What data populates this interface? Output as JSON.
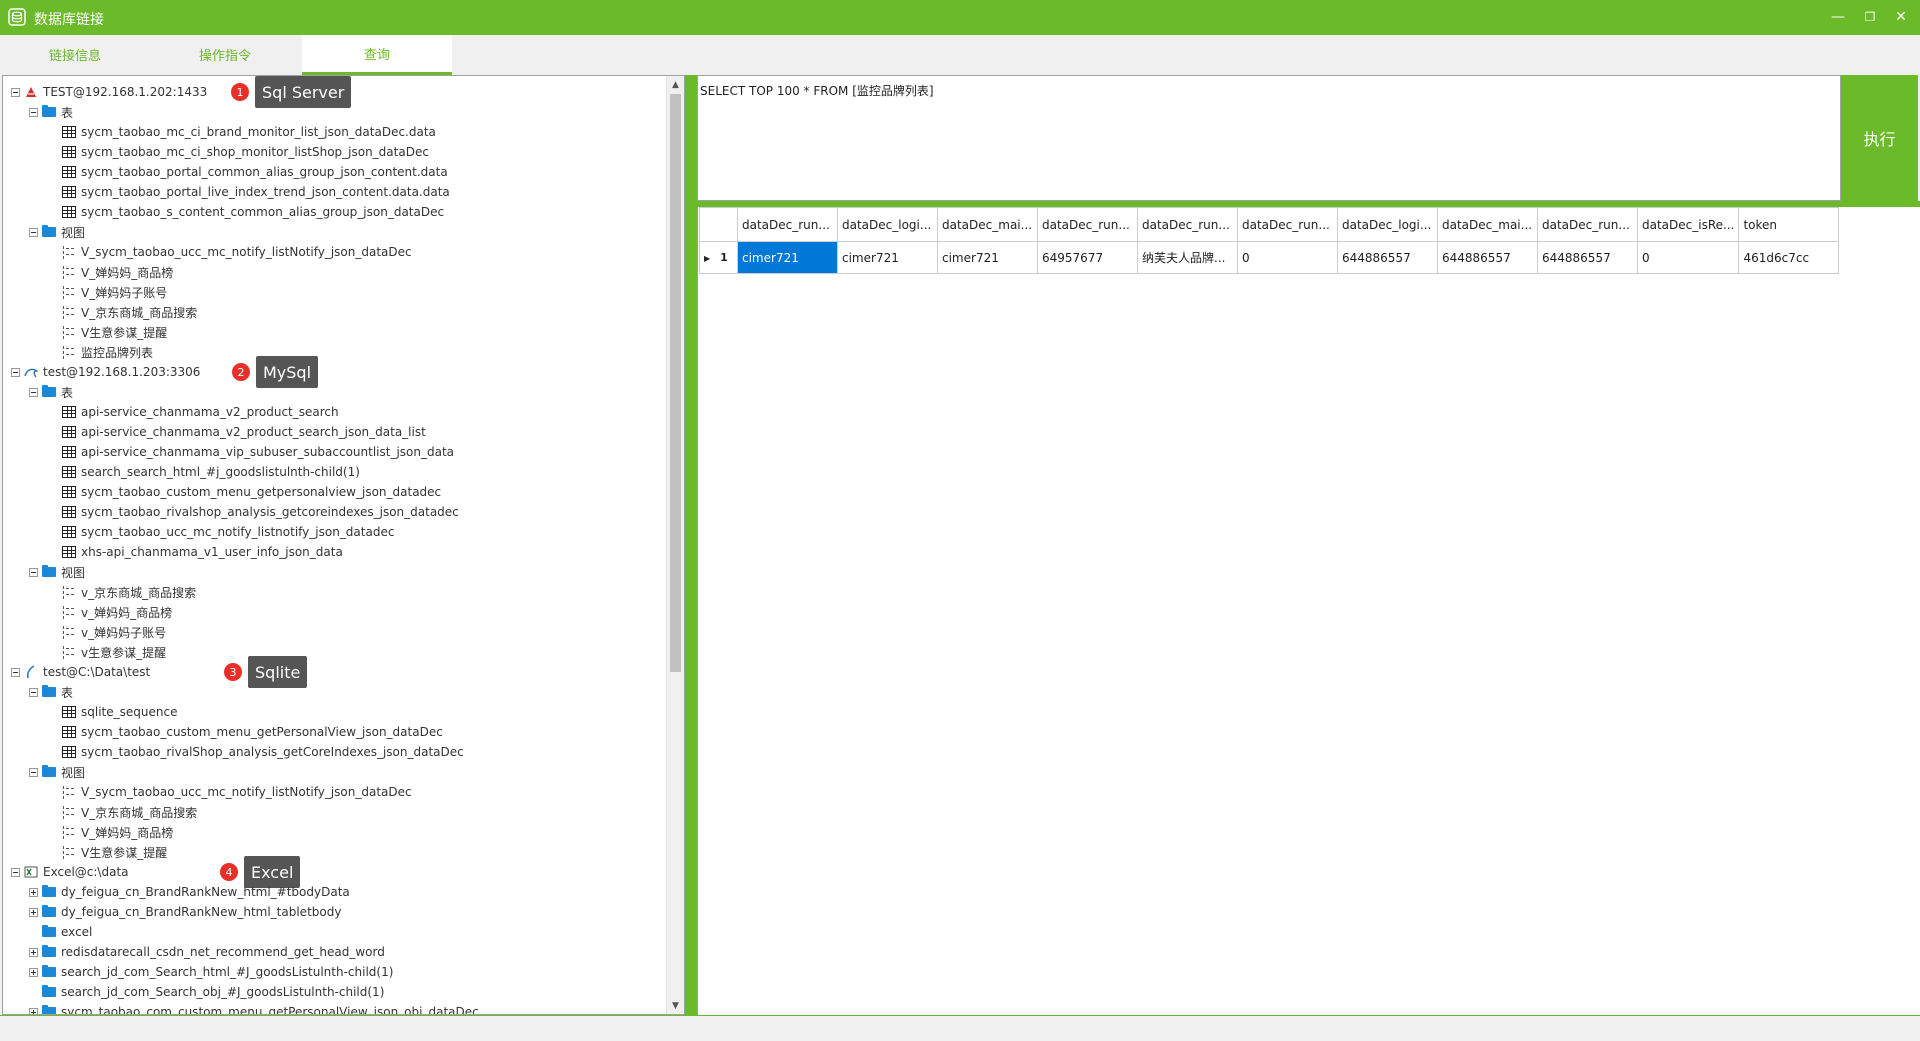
{
  "window": {
    "title": "数据库链接",
    "accent": "#6aba29",
    "controls": {
      "minimize": "—",
      "restore": "❐",
      "close": "✕"
    }
  },
  "tabs": [
    {
      "label": "链接信息",
      "active": false
    },
    {
      "label": "操作指令",
      "active": false
    },
    {
      "label": "查询",
      "active": true
    }
  ],
  "tree": {
    "connections": [
      {
        "label": "TEST@192.168.1.202:1433",
        "icon": "sqlserver-icon",
        "callout": {
          "number": "1",
          "label": "Sql Server"
        },
        "tables_label": "表",
        "tables": [
          "sycm_taobao_mc_ci_brand_monitor_list_json_dataDec.data",
          "sycm_taobao_mc_ci_shop_monitor_listShop_json_dataDec",
          "sycm_taobao_portal_common_alias_group_json_content.data",
          "sycm_taobao_portal_live_index_trend_json_content.data.data",
          "sycm_taobao_s_content_common_alias_group_json_dataDec"
        ],
        "views_label": "视图",
        "views": [
          "V_sycm_taobao_ucc_mc_notify_listNotify_json_dataDec",
          "V_婵妈妈_商品榜",
          "V_婵妈妈子账号",
          "V_京东商城_商品搜索",
          "V生意参谋_提醒",
          "监控品牌列表"
        ]
      },
      {
        "label": "test@192.168.1.203:3306",
        "icon": "mysql-icon",
        "callout": {
          "number": "2",
          "label": "MySql"
        },
        "tables_label": "表",
        "tables": [
          "api-service_chanmama_v2_product_search",
          "api-service_chanmama_v2_product_search_json_data_list",
          "api-service_chanmama_vip_subuser_subaccountlist_json_data",
          "search_search_html_#j_goodslistulnth-child(1)",
          "sycm_taobao_custom_menu_getpersonalview_json_datadec",
          "sycm_taobao_rivalshop_analysis_getcoreindexes_json_datadec",
          "sycm_taobao_ucc_mc_notify_listnotify_json_datadec",
          "xhs-api_chanmama_v1_user_info_json_data"
        ],
        "views_label": "视图",
        "views": [
          "v_京东商城_商品搜索",
          "v_婵妈妈_商品榜",
          "v_婵妈妈子账号",
          "v生意参谋_提醒"
        ]
      },
      {
        "label": "test@C:\\Data\\test",
        "icon": "sqlite-icon",
        "callout": {
          "number": "3",
          "label": "Sqlite"
        },
        "tables_label": "表",
        "tables": [
          "sqlite_sequence",
          "sycm_taobao_custom_menu_getPersonalView_json_dataDec",
          "sycm_taobao_rivalShop_analysis_getCoreIndexes_json_dataDec"
        ],
        "views_label": "视图",
        "views": [
          "V_sycm_taobao_ucc_mc_notify_listNotify_json_dataDec",
          "V_京东商城_商品搜索",
          "V_婵妈妈_商品榜",
          "V生意参谋_提醒"
        ]
      },
      {
        "label": "Excel@c:\\data",
        "icon": "excel-icon",
        "callout": {
          "number": "4",
          "label": "Excel"
        },
        "folders": [
          {
            "label": "dy_feigua_cn_BrandRankNew_html_#tbodyData",
            "expandable": true
          },
          {
            "label": "dy_feigua_cn_BrandRankNew_html_tabletbody",
            "expandable": true
          },
          {
            "label": "excel",
            "expandable": false
          },
          {
            "label": "redisdatarecall_csdn_net_recommend_get_head_word",
            "expandable": true
          },
          {
            "label": "search_jd_com_Search_html_#J_goodsListulnth-child(1)",
            "expandable": true
          },
          {
            "label": "search_jd_com_Search_obj_#J_goodsListulnth-child(1)",
            "expandable": false
          },
          {
            "label": "sycm_taobao_com_custom_menu_getPersonalView_json_obj_dataDec",
            "expandable": true
          }
        ]
      }
    ]
  },
  "query": {
    "sql": "SELECT TOP 100 * FROM [监控品牌列表]",
    "execute_label": "执行"
  },
  "result_grid": {
    "columns": [
      "dataDec_run...",
      "dataDec_logi...",
      "dataDec_mai...",
      "dataDec_run...",
      "dataDec_run...",
      "dataDec_run...",
      "dataDec_logi...",
      "dataDec_mai...",
      "dataDec_run...",
      "dataDec_isRe...",
      "token"
    ],
    "rows": [
      {
        "number": "1",
        "cells": [
          "cimer721",
          "cimer721",
          "cimer721",
          "64957677",
          "纳芙夫人品牌...",
          "0",
          "644886557",
          "644886557",
          "644886557",
          "0",
          "461d6c7cc"
        ]
      }
    ]
  }
}
